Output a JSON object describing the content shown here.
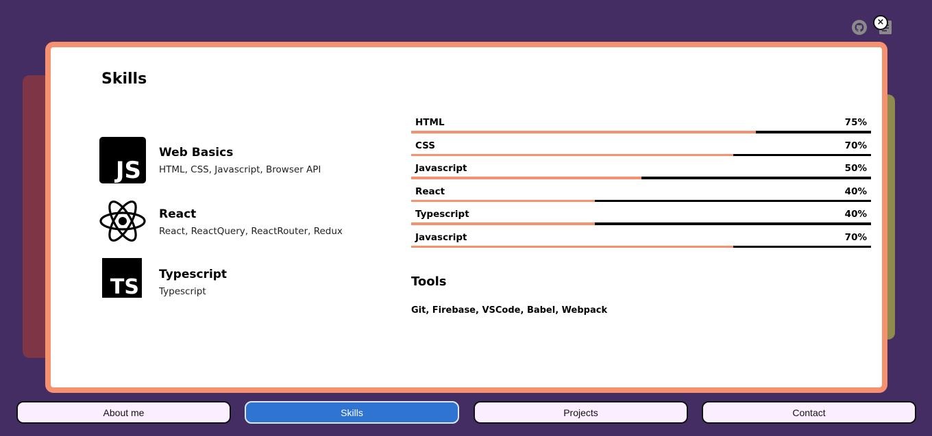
{
  "modal": {
    "title": "Skills",
    "close_label": "×"
  },
  "skills": [
    {
      "name": "Web Basics",
      "description": "HTML, CSS, Javascript, Browser API",
      "icon": "javascript-icon",
      "icon_text": "JS"
    },
    {
      "name": "React",
      "description": "React, ReactQuery, ReactRouter, Redux",
      "icon": "react-icon"
    },
    {
      "name": "Typescript",
      "description": "Typescript",
      "icon": "typescript-icon",
      "icon_text": "TS"
    }
  ],
  "bars": [
    {
      "label": "HTML",
      "percent_label": "75%",
      "value": 75
    },
    {
      "label": "CSS",
      "percent_label": "70%",
      "value": 70
    },
    {
      "label": "Javascript",
      "percent_label": "50%",
      "value": 50
    },
    {
      "label": "React",
      "percent_label": "40%",
      "value": 40
    },
    {
      "label": "Typescript",
      "percent_label": "40%",
      "value": 40
    },
    {
      "label": "Javascript",
      "percent_label": "70%",
      "value": 70
    }
  ],
  "tools": {
    "title": "Tools",
    "list": "Git, Firebase, VSCode, Babel, Webpack"
  },
  "nav": {
    "items": [
      {
        "label": "About me",
        "active": false
      },
      {
        "label": "Skills",
        "active": true
      },
      {
        "label": "Projects",
        "active": false
      },
      {
        "label": "Contact",
        "active": false
      }
    ]
  },
  "colors": {
    "background": "#432d63",
    "accent": "#f5916f",
    "active_nav": "#2f74d0",
    "nav_button": "#fbeefe"
  }
}
